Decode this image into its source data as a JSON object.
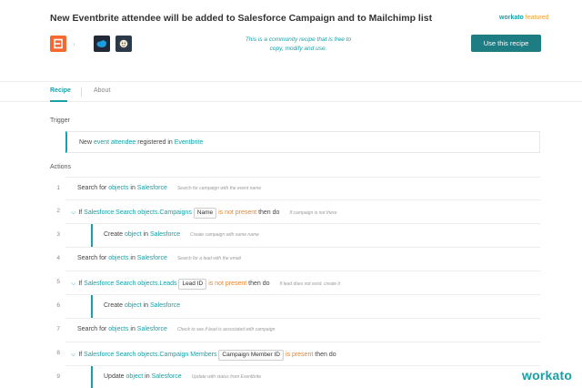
{
  "header": {
    "title": "New Eventbrite attendee will be added to Salesforce Campaign and to Mailchimp list",
    "featured_brand": "workato",
    "featured_label": "featured",
    "community_note": "This is a community recipe that is free to copy, modify and use.",
    "use_button": "Use this recipe",
    "apps": [
      "Eventbrite",
      "Salesforce",
      "Mailchimp"
    ]
  },
  "tabs": [
    {
      "label": "Recipe",
      "active": true
    },
    {
      "label": "About",
      "active": false
    }
  ],
  "trigger": {
    "section_label": "Trigger",
    "text": {
      "pre": "New",
      "object": "event attendee",
      "mid": "registered in",
      "app": "Eventbrite"
    }
  },
  "actions": {
    "section_label": "Actions",
    "steps": [
      {
        "num": "1",
        "pre": "Search for",
        "object": "objects",
        "mid": "in",
        "app": "Salesforce",
        "comment": "Search for campaign with the event name"
      },
      {
        "num": "2",
        "if": "If",
        "datapill_source": "Salesforce Search objects.Campaigns",
        "pill": "Name",
        "condition": "is not present",
        "then": "then do",
        "comment": "If campaign is not there"
      },
      {
        "num": "3",
        "pre": "Create",
        "object": "object",
        "mid": "in",
        "app": "Salesforce",
        "comment": "Create campaign with same name"
      },
      {
        "num": "4",
        "pre": "Search for",
        "object": "objects",
        "mid": "in",
        "app": "Salesforce",
        "comment": "Search for a lead with the email"
      },
      {
        "num": "5",
        "if": "If",
        "datapill_source": "Salesforce Search objects.Leads",
        "pill": "Lead ID",
        "condition": "is not present",
        "then": "then do",
        "comment": "If lead does not exist, create it"
      },
      {
        "num": "6",
        "pre": "Create",
        "object": "object",
        "mid": "in",
        "app": "Salesforce",
        "comment": ""
      },
      {
        "num": "7",
        "pre": "Search for",
        "object": "objects",
        "mid": "in",
        "app": "Salesforce",
        "comment": "Check to see if lead is associated with campaign"
      },
      {
        "num": "8",
        "if": "If",
        "datapill_source": "Salesforce Search objects.Campaign Members",
        "pill": "Campaign Member ID",
        "condition": "is present",
        "then": "then do",
        "comment": ""
      },
      {
        "num": "9",
        "pre": "Update",
        "object": "object",
        "mid": "in",
        "app": "Salesforce",
        "comment": "Update with status from Eventbrite"
      }
    ]
  },
  "watermark": "workato",
  "colors": {
    "accent": "#18a0a7",
    "button": "#1e7c83",
    "warning": "#e8842d",
    "eventbrite": "#f6682f"
  }
}
